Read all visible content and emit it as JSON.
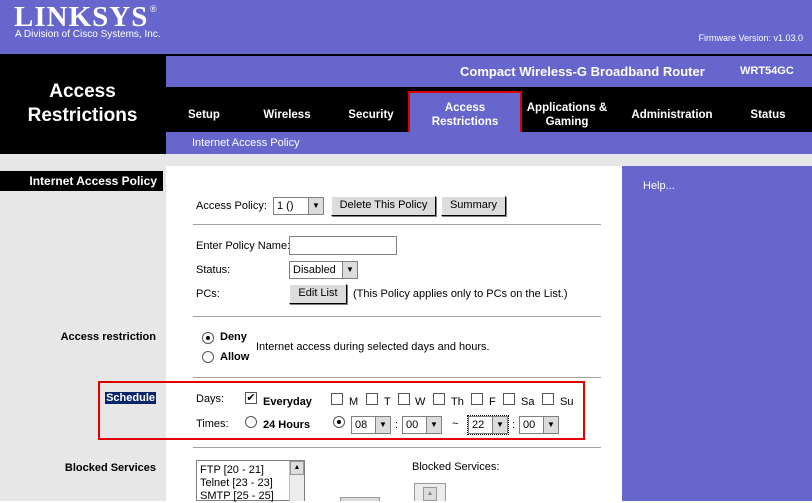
{
  "header": {
    "logo": "LINKSYS",
    "logo_reg": "®",
    "logo_sub": "A Division of Cisco Systems, Inc.",
    "firmware": "Firmware Version: v1.03.0",
    "page_title_line1": "Access",
    "page_title_line2": "Restrictions",
    "product_name": "Compact Wireless-G Broadband Router",
    "model": "WRT54GC"
  },
  "nav": {
    "setup": "Setup",
    "wireless": "Wireless",
    "security": "Security",
    "access_line1": "Access",
    "access_line2": "Restrictions",
    "apps_line1": "Applications &",
    "apps_line2": "Gaming",
    "administration": "Administration",
    "status": "Status",
    "subtab": "Internet Access Policy"
  },
  "left": {
    "section": "Internet Access Policy",
    "access_restriction": "Access restriction",
    "schedule": "Schedule",
    "blocked_services": "Blocked Services"
  },
  "help": {
    "link": "Help..."
  },
  "policy": {
    "label": "Access Policy:",
    "value": "1 ()",
    "delete_btn": "Delete This Policy",
    "summary_btn": "Summary",
    "name_label": "Enter Policy Name:",
    "name_value": "",
    "status_label": "Status:",
    "status_value": "Disabled",
    "pcs_label": "PCs:",
    "edit_list_btn": "Edit List",
    "pcs_note": "(This Policy applies only to PCs on the List.)"
  },
  "restriction": {
    "deny": "Deny",
    "allow": "Allow",
    "note": "Internet access during selected days and hours.",
    "selected": "deny"
  },
  "schedule": {
    "days_label": "Days:",
    "everyday": "Everyday",
    "everyday_checked": true,
    "days": [
      "M",
      "T",
      "W",
      "Th",
      "F",
      "Sa",
      "Su"
    ],
    "times_label": "Times:",
    "hours24": "24 Hours",
    "start_hour": "08",
    "start_min": "00",
    "separator": ":",
    "tilde": "~",
    "end_hour": "22",
    "end_min": "00"
  },
  "services": {
    "list": [
      "FTP [20 - 21]",
      "Telnet [23 - 23]",
      "SMTP [25 - 25]"
    ],
    "blocked_label": "Blocked Services:"
  },
  "colors": {
    "brand": "#6666cc",
    "highlight": "#e00000"
  }
}
